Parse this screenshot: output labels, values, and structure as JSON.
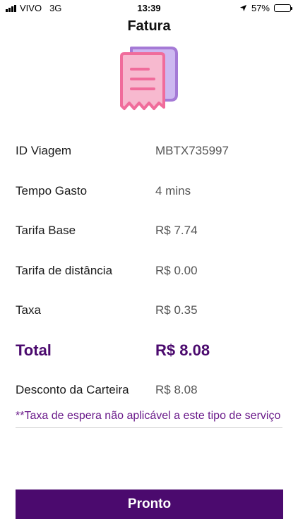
{
  "status_bar": {
    "carrier": "VIVO",
    "network": "3G",
    "time": "13:39",
    "battery": "57%",
    "battery_level": 0.57,
    "icons": [
      "signal-icon",
      "location-arrow-icon",
      "battery-icon"
    ]
  },
  "header": {
    "title": "Fatura",
    "icon": "receipt-icon"
  },
  "invoice": {
    "rows": [
      {
        "label": "ID Viagem",
        "value": "MBTX735997"
      },
      {
        "label": "Tempo Gasto",
        "value": "4 mins"
      },
      {
        "label": "Tarifa Base",
        "value": "R$ 7.74"
      },
      {
        "label": "Tarifa de distância",
        "value": "R$ 0.00"
      },
      {
        "label": "Taxa",
        "value": "R$ 0.35"
      }
    ],
    "total": {
      "label": "Total",
      "value": "R$ 8.08"
    },
    "discount": {
      "label": "Desconto da Carteira",
      "value": "R$ 8.08"
    }
  },
  "note": "**Taxa de espera não aplicável a este tipo de serviço",
  "actions": {
    "done_label": "Pronto"
  },
  "colors": {
    "primary": "#4b0a6e",
    "note": "#6a1a8a",
    "receipt_front": "#f06c9b",
    "receipt_back": "#a57ad6"
  }
}
